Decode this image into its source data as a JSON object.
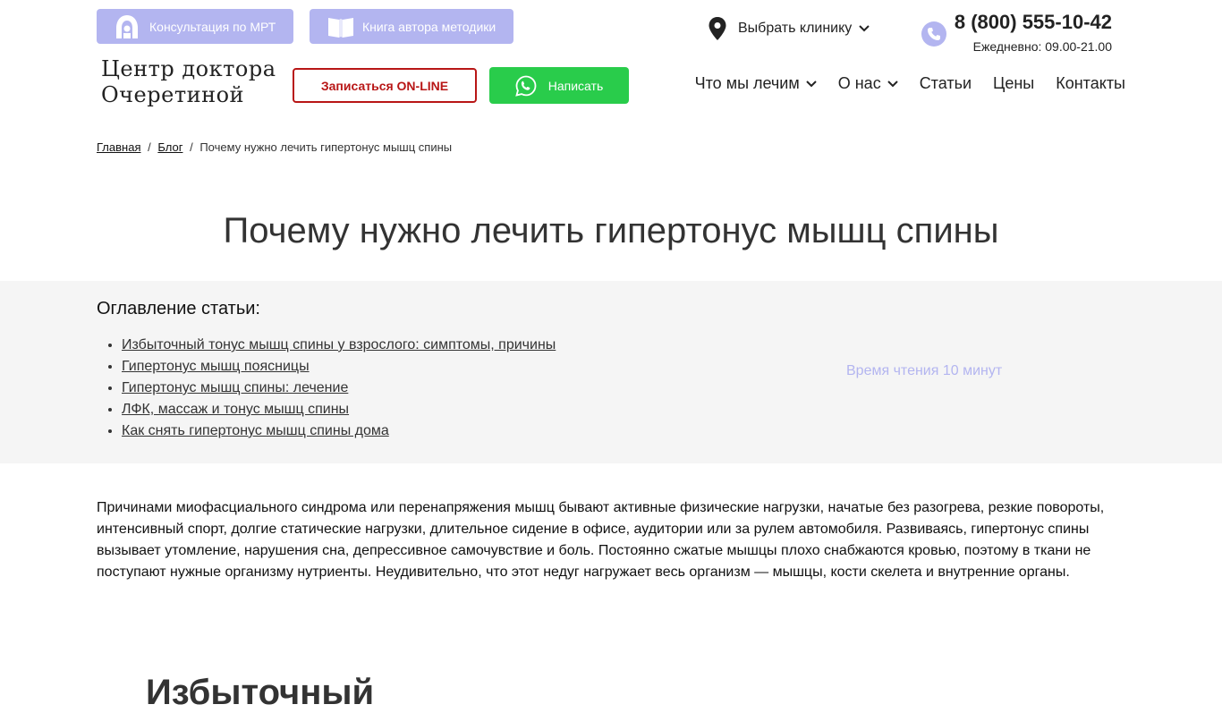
{
  "topbar": {
    "mri_label": "Консультация по МРТ",
    "book_label": "Книга автора методики",
    "clinic_label": "Выбрать клинику",
    "phone": "8 (800) 555-10-42",
    "hours": "Ежедневно: 09.00-21.00"
  },
  "header": {
    "logo_line1": "Центр доктора",
    "logo_line2": "Очеретиной",
    "online_label": "Записаться ON-LINE",
    "whatsapp_label": "Написать"
  },
  "nav": {
    "items": [
      {
        "label": "Что мы лечим"
      },
      {
        "label": "О нас"
      },
      {
        "label": "Статьи"
      },
      {
        "label": "Цены"
      },
      {
        "label": "Контакты"
      }
    ]
  },
  "breadcrumb": {
    "home": "Главная",
    "sep1": "/",
    "blog": "Блог",
    "sep2": "/",
    "current": "Почему нужно лечить гипертонус мышц спины"
  },
  "article": {
    "title": "Почему нужно лечить гипертонус мышц спины",
    "toc_heading": "Оглавление статьи:",
    "toc": [
      "Избыточный тонус мышц спины у взрослого: симптомы, причины ",
      "Гипертонус мышц поясницы ",
      "Гипертонус мышц спины: лечение ",
      "ЛФК, массаж и тонус мышц спины ",
      "Как снять гипертонус мышц спины дома "
    ],
    "read_time": "Время чтения 10 минут",
    "paragraph": "Причинами миофасциального синдрома или перенапряжения мышц бывают активные физические нагрузки, начатые без разогрева, резкие повороты, интенсивный спорт, долгие статические нагрузки, длительное сидение в офисе, аудитории или за рулем автомобиля. Развиваясь, гипертонус спины вызывает утомление, нарушения сна, депрессивное самочувствие и боль. Постоянно сжатые мышцы плохо снабжаются кровью, поэтому в ткани не поступают нужные организму нутриенты. Неудивительно, что этот недуг нагружает весь организм — мышцы, кости скелета и внутренние органы.",
    "next_heading": "Избыточный"
  },
  "colors": {
    "accent_lilac": "#b3b5f0",
    "online_red": "#b81616",
    "whatsapp_green": "#29cc4b",
    "toc_bg": "#f5f5f5"
  },
  "icons": {
    "mri": "mri-scanner-icon",
    "book": "open-book-icon",
    "clinic": "map-pin-icon",
    "phone": "phone-icon",
    "whatsapp": "whatsapp-icon",
    "chevron": "chevron-down-icon"
  }
}
